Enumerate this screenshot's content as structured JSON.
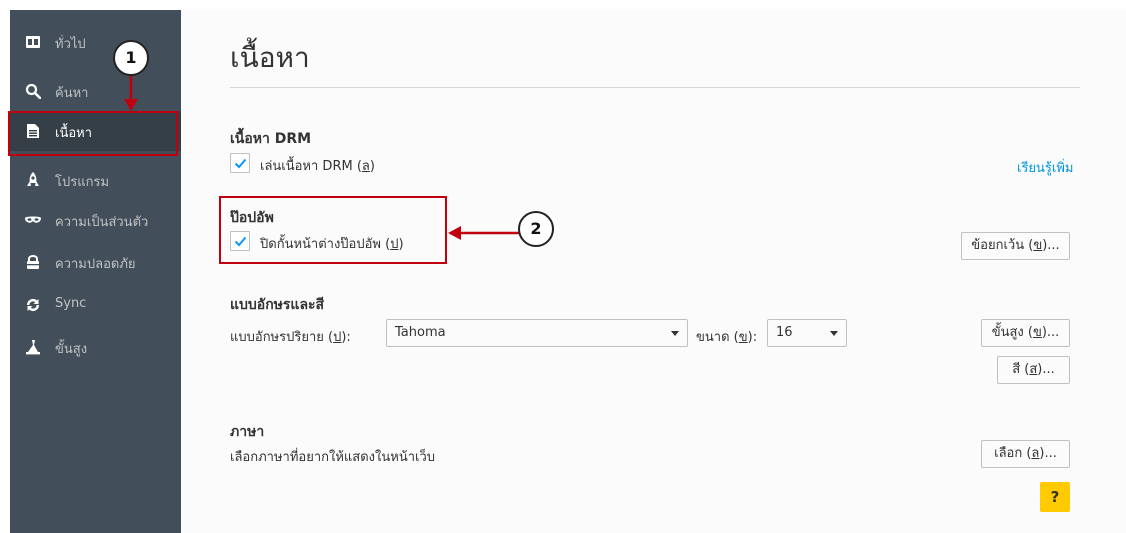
{
  "sidebar": {
    "items": [
      {
        "label": "ทั่วไป",
        "icon": "general-icon"
      },
      {
        "label": "ค้นหา",
        "icon": "search-icon"
      },
      {
        "label": "เนื้อหา",
        "icon": "content-icon",
        "selected": true
      },
      {
        "label": "โปรแกรม",
        "icon": "applications-icon"
      },
      {
        "label": "ความเป็นส่วนตัว",
        "icon": "privacy-icon"
      },
      {
        "label": "ความปลอดภัย",
        "icon": "security-icon"
      },
      {
        "label": "Sync",
        "icon": "sync-icon"
      },
      {
        "label": "ขั้นสูง",
        "icon": "advanced-icon"
      }
    ]
  },
  "main": {
    "title": "เนื้อหา",
    "drm": {
      "heading": "เนื้อหา DRM",
      "checkbox_label": "เล่นเนื้อหา DRM (",
      "checkbox_key": "ล",
      "checked": true,
      "learn_more": "เรียนรู้เพิ่ม"
    },
    "popups": {
      "heading": "ป๊อปอัพ",
      "checkbox_label": "ปิดกั้นหน้าต่างป๊อปอัพ (",
      "checkbox_key": "ป",
      "checked": true,
      "exceptions_label": "ข้อยกเว้น (",
      "exceptions_key": "ข"
    },
    "fonts": {
      "heading": "แบบอักษรและสี",
      "default_font_label": "แบบอักษรปริยาย (",
      "default_font_key": "ป",
      "default_font_value": "Tahoma",
      "size_label": "ขนาด (",
      "size_key": "ข",
      "size_value": "16",
      "advanced_label": "ขั้นสูง (",
      "advanced_key": "ข",
      "colors_label": "สี (",
      "colors_key": "ส"
    },
    "languages": {
      "heading": "ภาษา",
      "description": "เลือกภาษาที่อยากให้แสดงในหน้าเว็บ",
      "choose_label": "เลือก (",
      "choose_key": "ล"
    },
    "help_label": "?"
  },
  "annotations": {
    "badge1": "1",
    "badge2": "2",
    "color": "#c0000f"
  },
  "colors": {
    "sidebar_bg": "#424f5a",
    "sidebar_selected": "#343f48",
    "link": "#0096dd",
    "check": "#0996f8",
    "help": "#ffcb00"
  }
}
